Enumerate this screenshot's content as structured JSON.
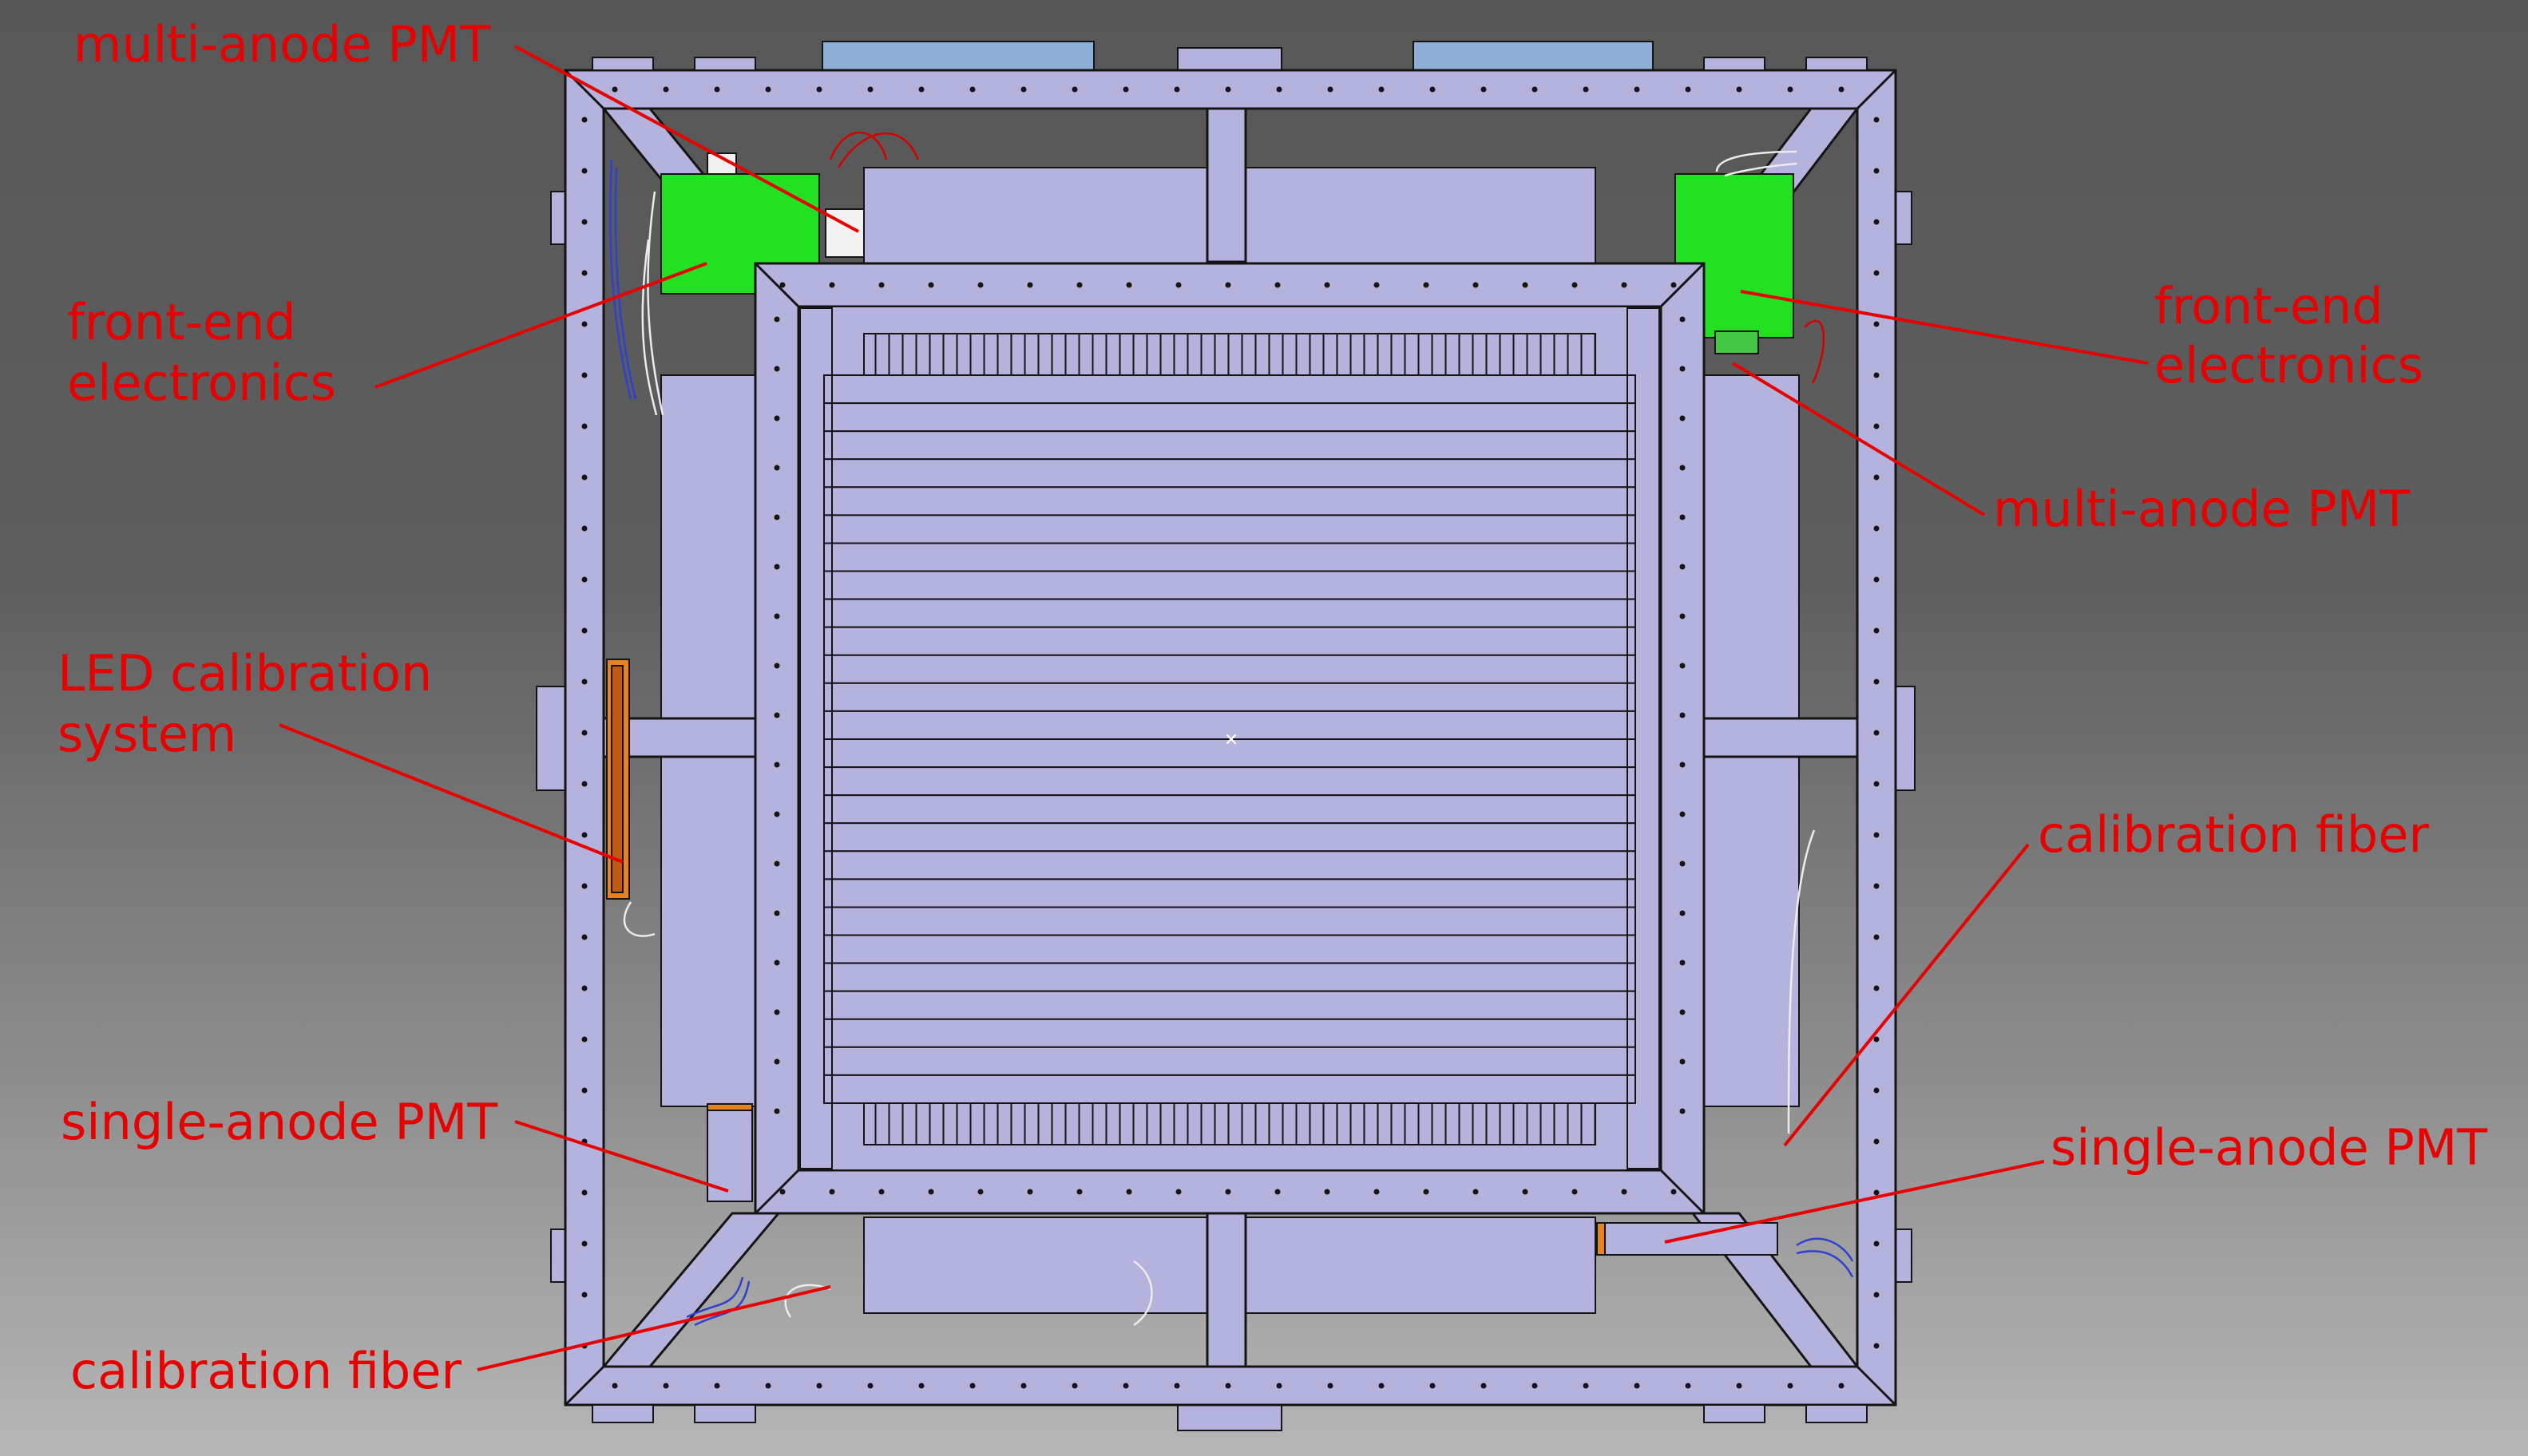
{
  "labels": {
    "multi_anode_pmt_top_left": "multi-anode PMT",
    "front_end_electronics_left_line1": "front-end",
    "front_end_electronics_left_line2": "electronics",
    "front_end_electronics_right_line1": "front-end",
    "front_end_electronics_right_line2": "electronics",
    "multi_anode_pmt_right": "multi-anode PMT",
    "led_calibration_system_line1": "LED calibration",
    "led_calibration_system_line2": "system",
    "calibration_fiber_right": "calibration fiber",
    "single_anode_pmt_left": "single-anode PMT",
    "single_anode_pmt_right": "single-anode PMT",
    "calibration_fiber_bottom_left": "calibration fiber"
  },
  "colors": {
    "label_red": "#e80000",
    "frame_lavender": "#b3b3dd",
    "electronics_green": "#22e022",
    "led_orange": "#e8821e",
    "outline": "#141414",
    "cable_white": "#ececec",
    "cable_blue": "#2f3fd0",
    "cable_red": "#d40000"
  },
  "counts": {
    "scintillator_bars": 26
  }
}
